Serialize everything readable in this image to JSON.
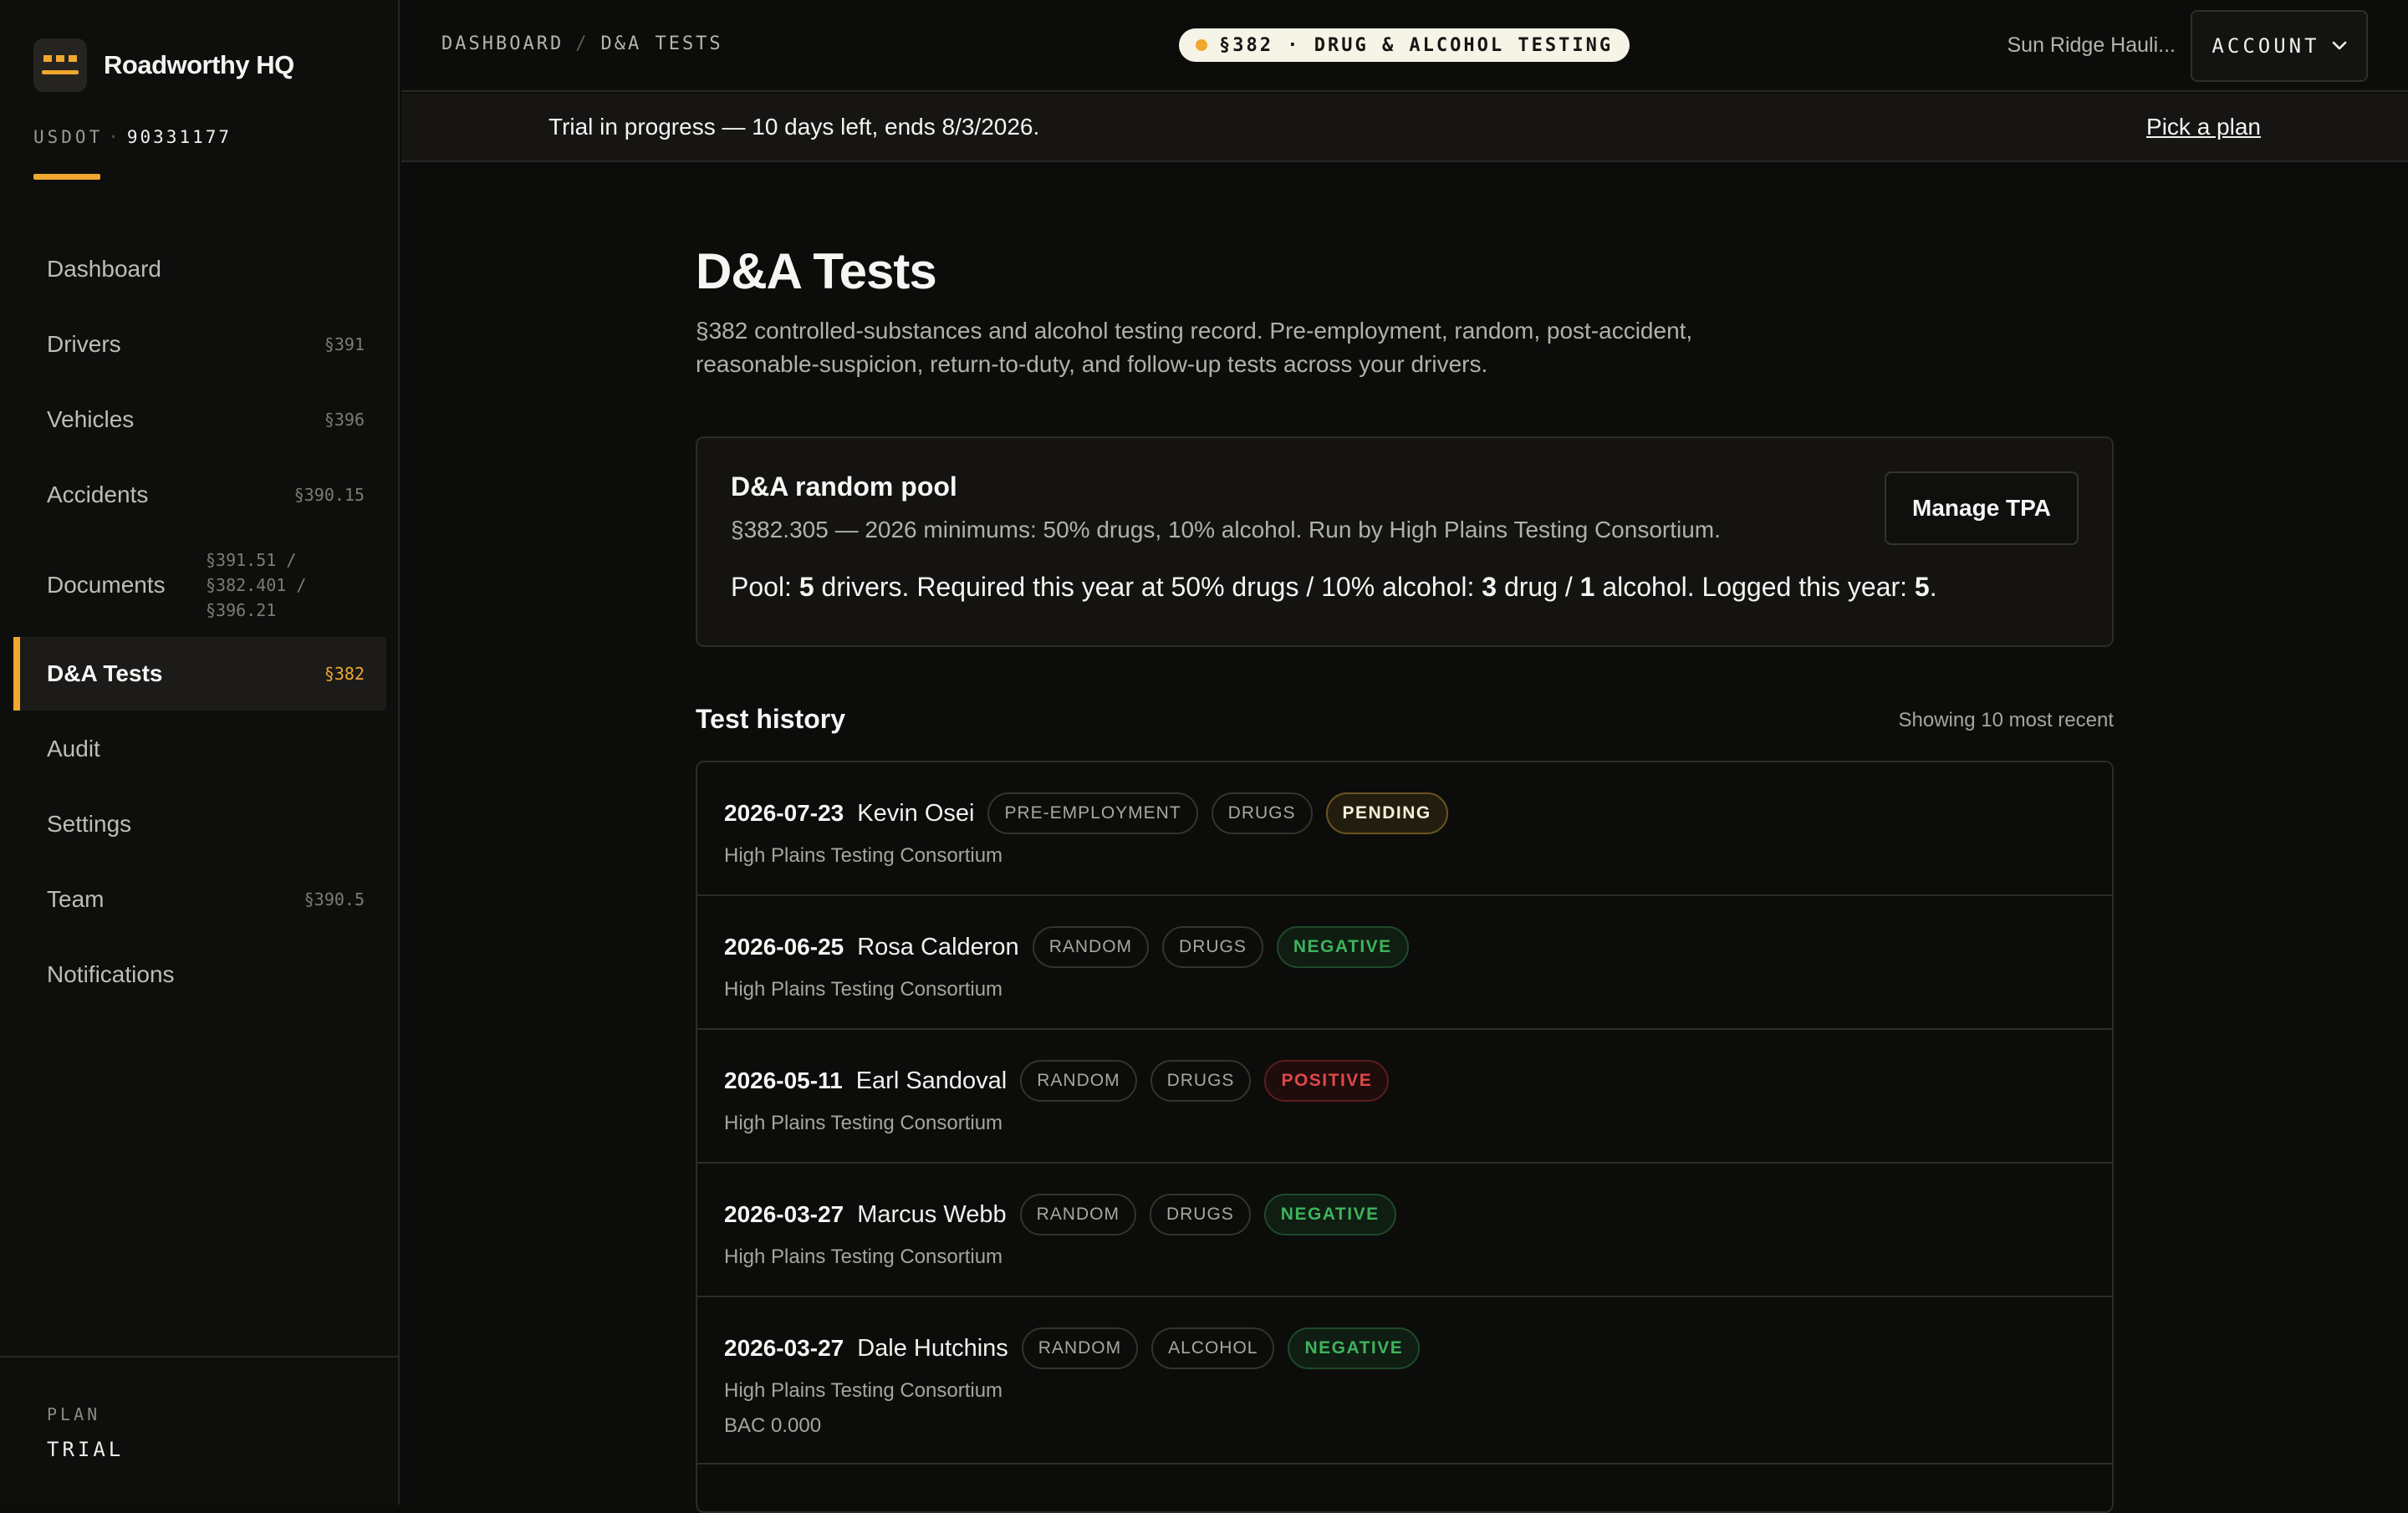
{
  "brand": {
    "name": "Roadworthy HQ",
    "usdot_label": "USDOT",
    "usdot_sep": "·",
    "usdot_number": "90331177"
  },
  "nav": {
    "items": [
      {
        "label": "Dashboard",
        "code": ""
      },
      {
        "label": "Drivers",
        "code": "§391"
      },
      {
        "label": "Vehicles",
        "code": "§396"
      },
      {
        "label": "Accidents",
        "code": "§390.15"
      },
      {
        "label": "Documents",
        "code_lines": [
          "§391.51 /",
          "§382.401 /",
          "§396.21"
        ]
      },
      {
        "label": "D&A Tests",
        "code": "§382",
        "active": true
      },
      {
        "label": "Audit",
        "code": ""
      },
      {
        "label": "Settings",
        "code": ""
      },
      {
        "label": "Team",
        "code": "§390.5"
      },
      {
        "label": "Notifications",
        "code": ""
      }
    ]
  },
  "plan": {
    "label": "PLAN",
    "value": "TRIAL"
  },
  "topbar": {
    "crumb_1": "DASHBOARD",
    "crumb_sep": "/",
    "crumb_2": "D&A TESTS",
    "regulation_pill": "§382 · DRUG & ALCOHOL TESTING",
    "company": "Sun Ridge Hauli...",
    "account_label": "ACCOUNT"
  },
  "trial": {
    "text": "Trial in progress — 10 days left, ends 8/3/2026.",
    "link": "Pick a plan"
  },
  "page": {
    "title": "D&A Tests",
    "description": "§382 controlled-substances and alcohol testing record. Pre-employment, random, post-accident, reasonable-suspicion, return-to-duty, and follow-up tests across your drivers."
  },
  "pool": {
    "title": "D&A random pool",
    "subtitle": "§382.305 — 2026 minimums: 50% drugs, 10% alcohol. Run by High Plains Testing Consortium.",
    "stats": {
      "t1": "Pool: ",
      "drivers": "5",
      "t2": " drivers. Required this year at 50% drugs / 10% alcohol: ",
      "drug_required": "3",
      "t3": " drug / ",
      "alcohol_required": "1",
      "t4": " alcohol. Logged this year: ",
      "logged": "5",
      "t5": "."
    },
    "button": "Manage TPA"
  },
  "history": {
    "title": "Test history",
    "count_label": "Showing 10 most recent",
    "rows": [
      {
        "date": "2026-07-23",
        "driver": "Kevin Osei",
        "type": "PRE-EMPLOYMENT",
        "substance": "DRUGS",
        "result": "PENDING",
        "result_kind": "pending",
        "provider": "High Plains Testing Consortium"
      },
      {
        "date": "2026-06-25",
        "driver": "Rosa Calderon",
        "type": "RANDOM",
        "substance": "DRUGS",
        "result": "NEGATIVE",
        "result_kind": "negative",
        "provider": "High Plains Testing Consortium"
      },
      {
        "date": "2026-05-11",
        "driver": "Earl Sandoval",
        "type": "RANDOM",
        "substance": "DRUGS",
        "result": "POSITIVE",
        "result_kind": "positive",
        "provider": "High Plains Testing Consortium"
      },
      {
        "date": "2026-03-27",
        "driver": "Marcus Webb",
        "type": "RANDOM",
        "substance": "DRUGS",
        "result": "NEGATIVE",
        "result_kind": "negative",
        "provider": "High Plains Testing Consortium"
      },
      {
        "date": "2026-03-27",
        "driver": "Dale Hutchins",
        "type": "RANDOM",
        "substance": "ALCOHOL",
        "result": "NEGATIVE",
        "result_kind": "negative",
        "provider": "High Plains Testing Consortium",
        "note": "BAC 0.000"
      }
    ]
  },
  "colors": {
    "accent": "#f0a72e",
    "negative": "#3fb35c",
    "positive": "#e04848",
    "background": "#0c0c0b"
  }
}
